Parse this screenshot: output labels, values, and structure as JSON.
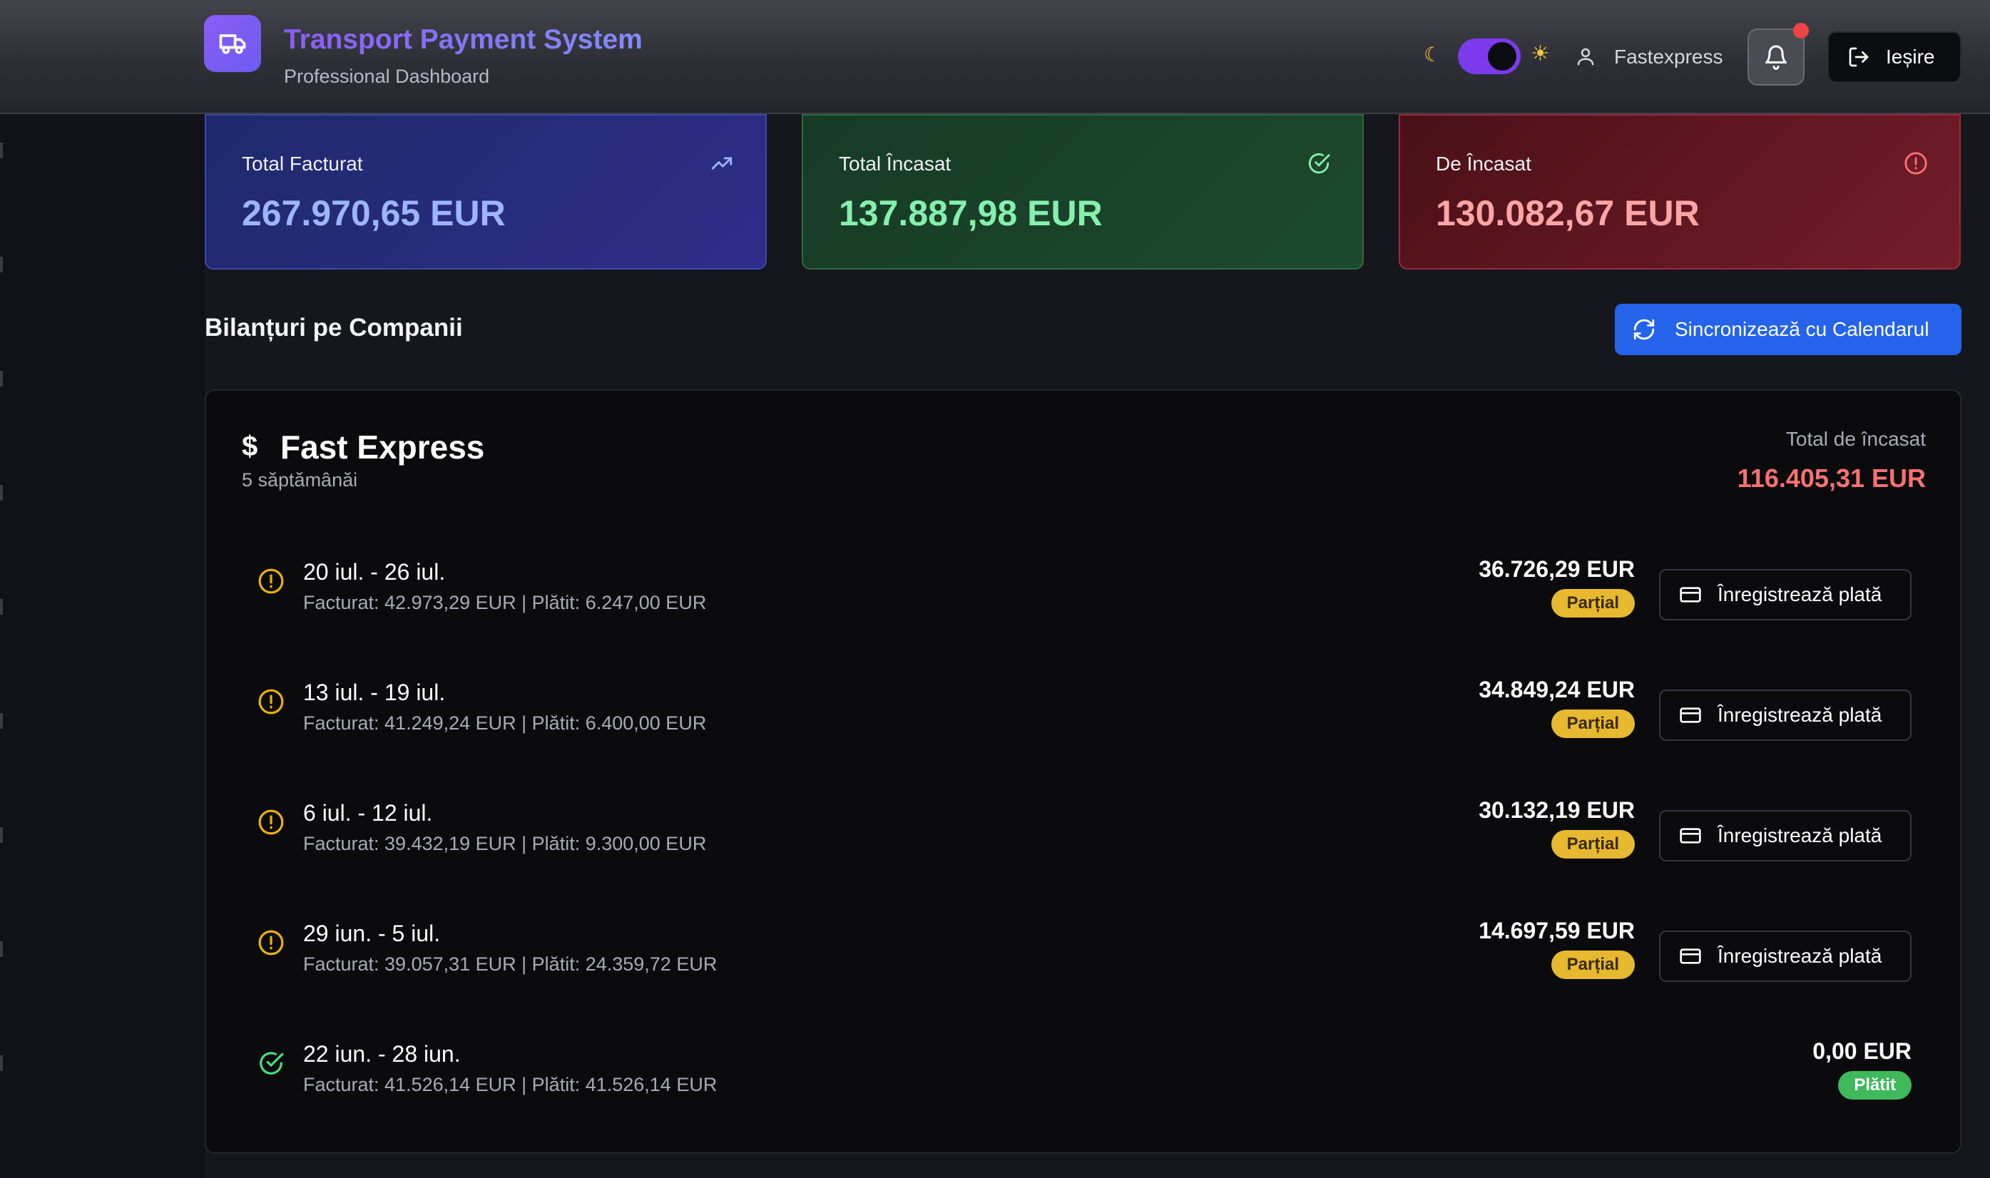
{
  "header": {
    "title": "Transport Payment System",
    "subtitle": "Professional Dashboard",
    "user_name": "Fastexpress",
    "logout_label": "Ieșire",
    "theme_toggle_on": true,
    "notification_dot": true
  },
  "summary": {
    "total_billed": {
      "label": "Total Facturat",
      "value": "267.970,65 EUR",
      "icon": "trending-up-icon"
    },
    "total_collected": {
      "label": "Total Încasat",
      "value": "137.887,98 EUR",
      "icon": "check-circle-icon"
    },
    "to_collect": {
      "label": "De Încasat",
      "value": "130.082,67 EUR",
      "icon": "alert-circle-icon"
    }
  },
  "section": {
    "title": "Bilanțuri pe Companii",
    "sync_label": "Sincronizează cu Calendarul"
  },
  "company": {
    "name": "Fast Express",
    "weeks_label": "5 săptămânăi",
    "total_label": "Total de încasat",
    "total_value": "116.405,31 EUR",
    "weeks": [
      {
        "range": "20 iul. - 26 iul.",
        "detail": "Facturat: 42.973,29 EUR | Plătit: 6.247,00 EUR",
        "amount": "36.726,29 EUR",
        "status": "Parțial",
        "action": "Înregistrează plată"
      },
      {
        "range": "13 iul. - 19 iul.",
        "detail": "Facturat: 41.249,24 EUR | Plătit: 6.400,00 EUR",
        "amount": "34.849,24 EUR",
        "status": "Parțial",
        "action": "Înregistrează plată"
      },
      {
        "range": "6 iul. - 12 iul.",
        "detail": "Facturat: 39.432,19 EUR | Plătit: 9.300,00 EUR",
        "amount": "30.132,19 EUR",
        "status": "Parțial",
        "action": "Înregistrează plată"
      },
      {
        "range": "29 iun. - 5 iul.",
        "detail": "Facturat: 39.057,31 EUR | Plătit: 24.359,72 EUR",
        "amount": "14.697,59 EUR",
        "status": "Parțial",
        "action": "Înregistrează plată"
      },
      {
        "range": "22 iun. - 28 iun.",
        "detail": "Facturat: 41.526,14 EUR | Plătit: 41.526,14 EUR",
        "amount": "0,00 EUR",
        "status": "Plătit",
        "action": ""
      }
    ]
  }
}
